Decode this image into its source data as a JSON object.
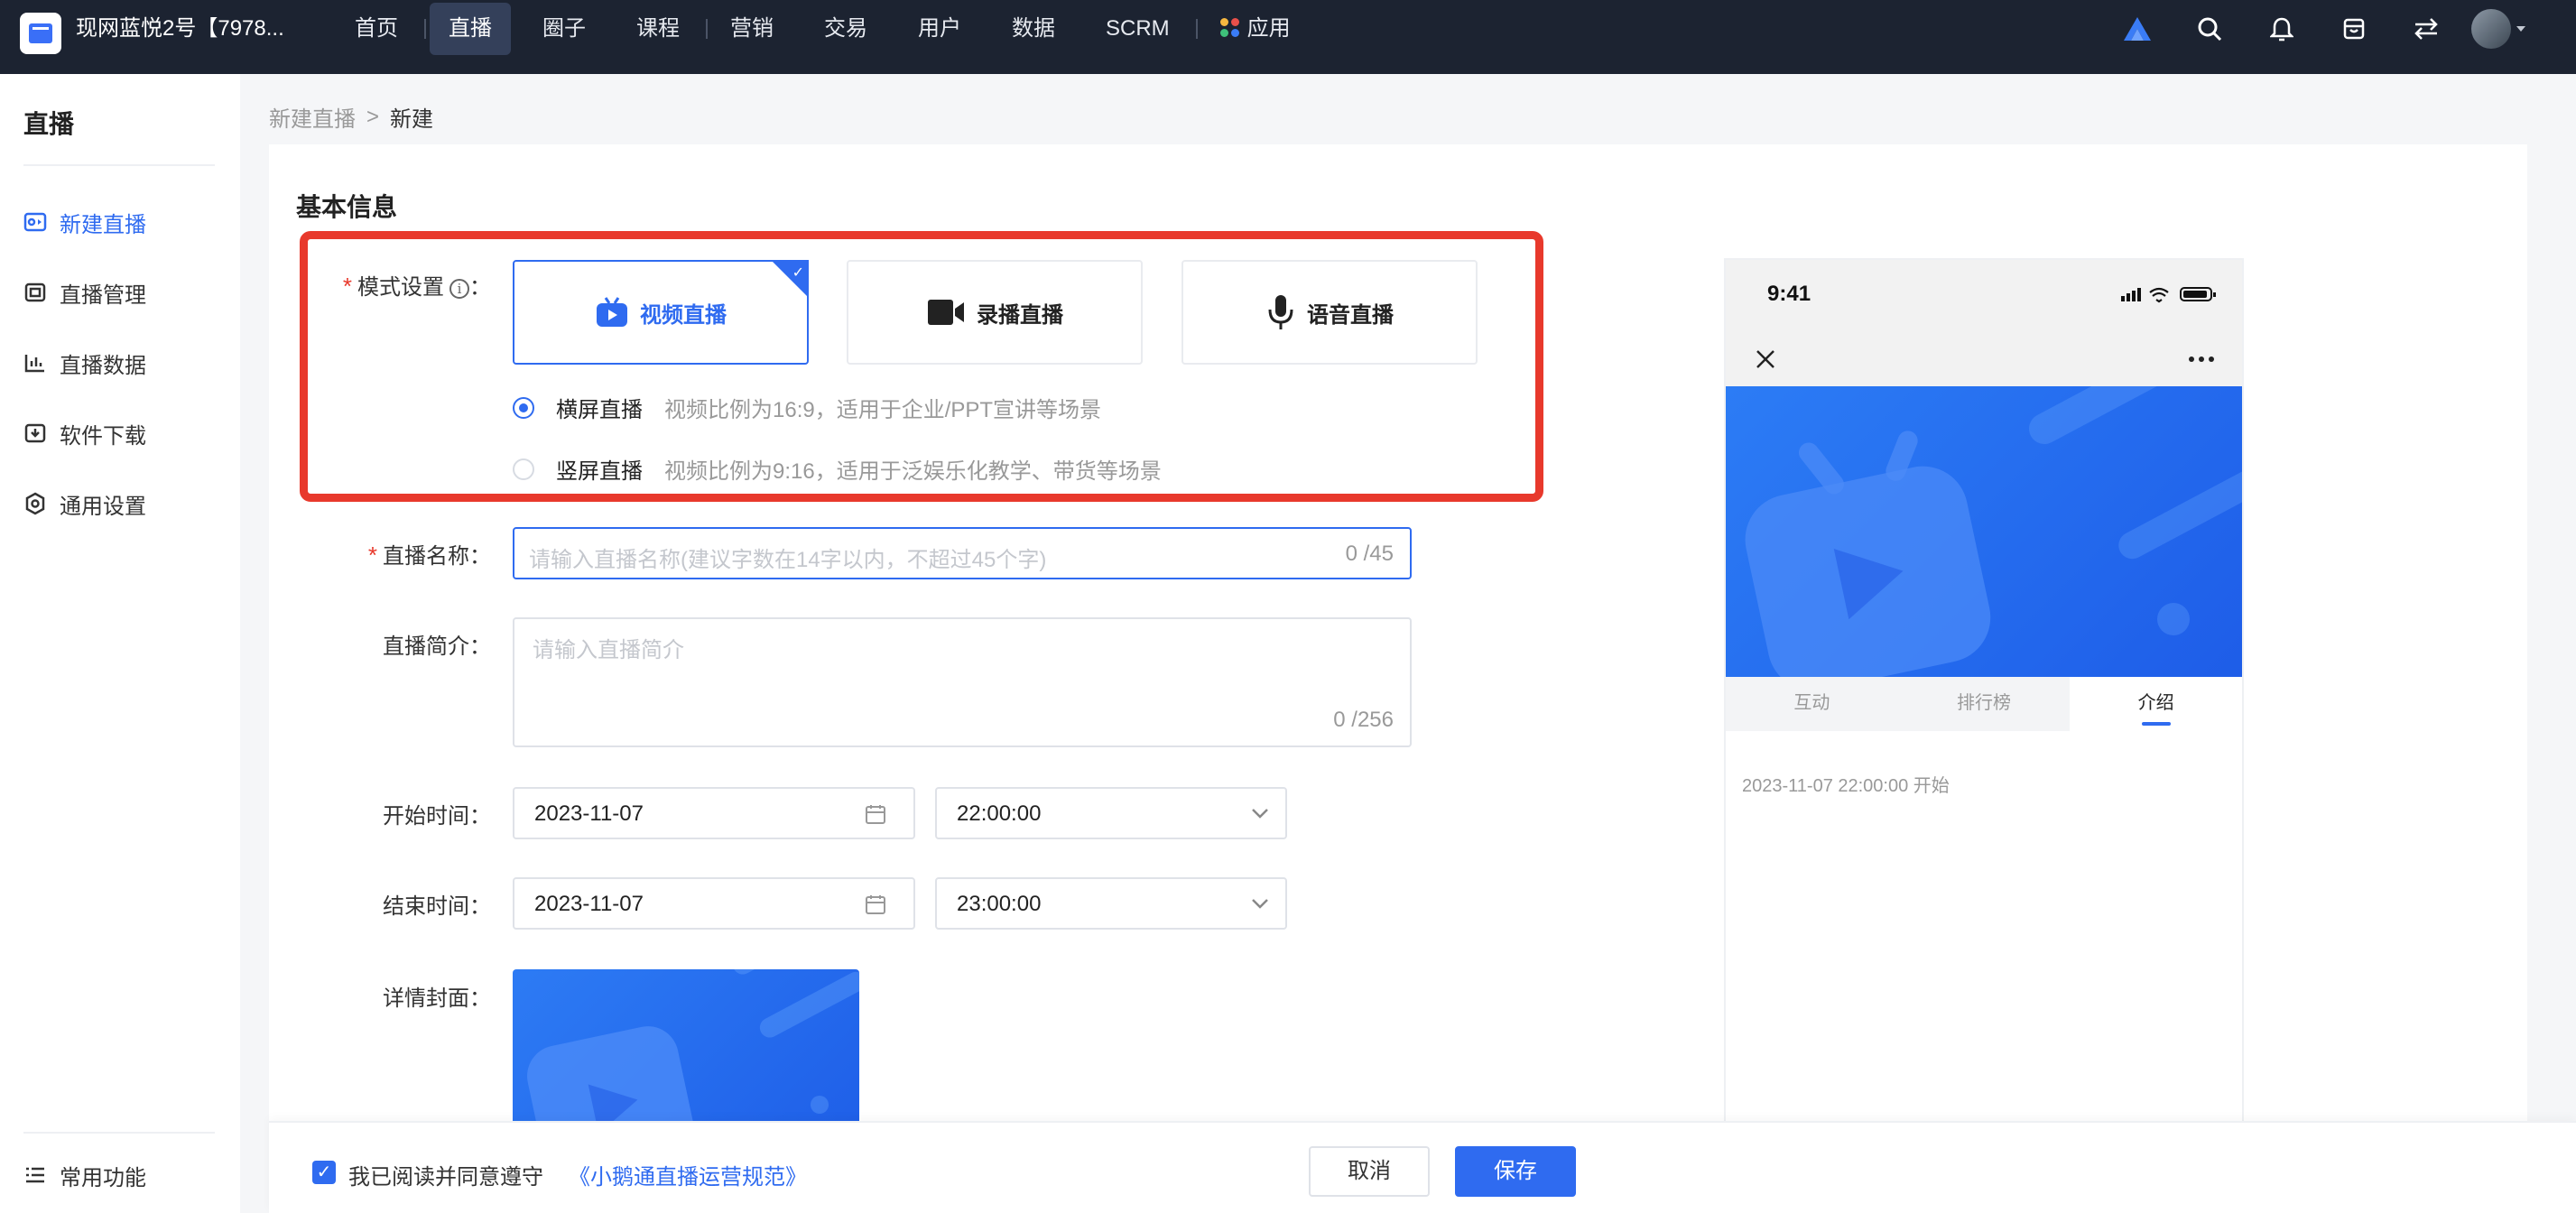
{
  "header": {
    "shop_name": "现网蓝悦2号【7978...",
    "nav": [
      "首页",
      "直播",
      "圈子",
      "课程",
      "营销",
      "交易",
      "用户",
      "数据",
      "SCRM",
      "应用"
    ],
    "active_nav": "直播"
  },
  "sidebar": {
    "title": "直播",
    "items": [
      {
        "label": "新建直播",
        "icon": "live-video-icon",
        "active": true
      },
      {
        "label": "直播管理",
        "icon": "manage-icon",
        "active": false
      },
      {
        "label": "直播数据",
        "icon": "chart-icon",
        "active": false
      },
      {
        "label": "软件下载",
        "icon": "download-icon",
        "active": false
      },
      {
        "label": "通用设置",
        "icon": "gear-icon",
        "active": false
      }
    ],
    "bottom_item": "常用功能"
  },
  "breadcrumb": {
    "parent": "新建直播",
    "current": "新建"
  },
  "form": {
    "section_title": "基本信息",
    "mode": {
      "label": "模式设置",
      "options": [
        "视频直播",
        "录播直播",
        "语音直播"
      ],
      "selected": "视频直播"
    },
    "orientation": [
      {
        "label": "横屏直播",
        "desc": "视频比例为16:9，适用于企业/PPT宣讲等场景",
        "checked": true
      },
      {
        "label": "竖屏直播",
        "desc": "视频比例为9:16，适用于泛娱乐化教学、带货等场景",
        "checked": false
      }
    ],
    "name": {
      "label": "直播名称",
      "placeholder": "请输入直播名称(建议字数在14字以内，不超过45个字)",
      "counter": "0 /45"
    },
    "intro": {
      "label": "直播简介",
      "placeholder": "请输入直播简介",
      "counter": "0 /256"
    },
    "start": {
      "label": "开始时间",
      "date": "2023-11-07",
      "time": "22:00:00"
    },
    "end": {
      "label": "结束时间",
      "date": "2023-11-07",
      "time": "23:00:00"
    },
    "cover_label": "详情封面"
  },
  "preview": {
    "time": "9:41",
    "tabs": [
      "互动",
      "排行榜",
      "介绍"
    ],
    "active_tab": "介绍",
    "start_text": "2023-11-07 22:00:00 开始"
  },
  "footer": {
    "agree_text": "我已阅读并同意遵守",
    "agree_link": "《小鹅通直播运营规范》",
    "cancel": "取消",
    "save": "保存"
  },
  "colors": {
    "accent": "#2f6bf0",
    "highlight": "#e8392c",
    "topbar": "#1c2331"
  }
}
